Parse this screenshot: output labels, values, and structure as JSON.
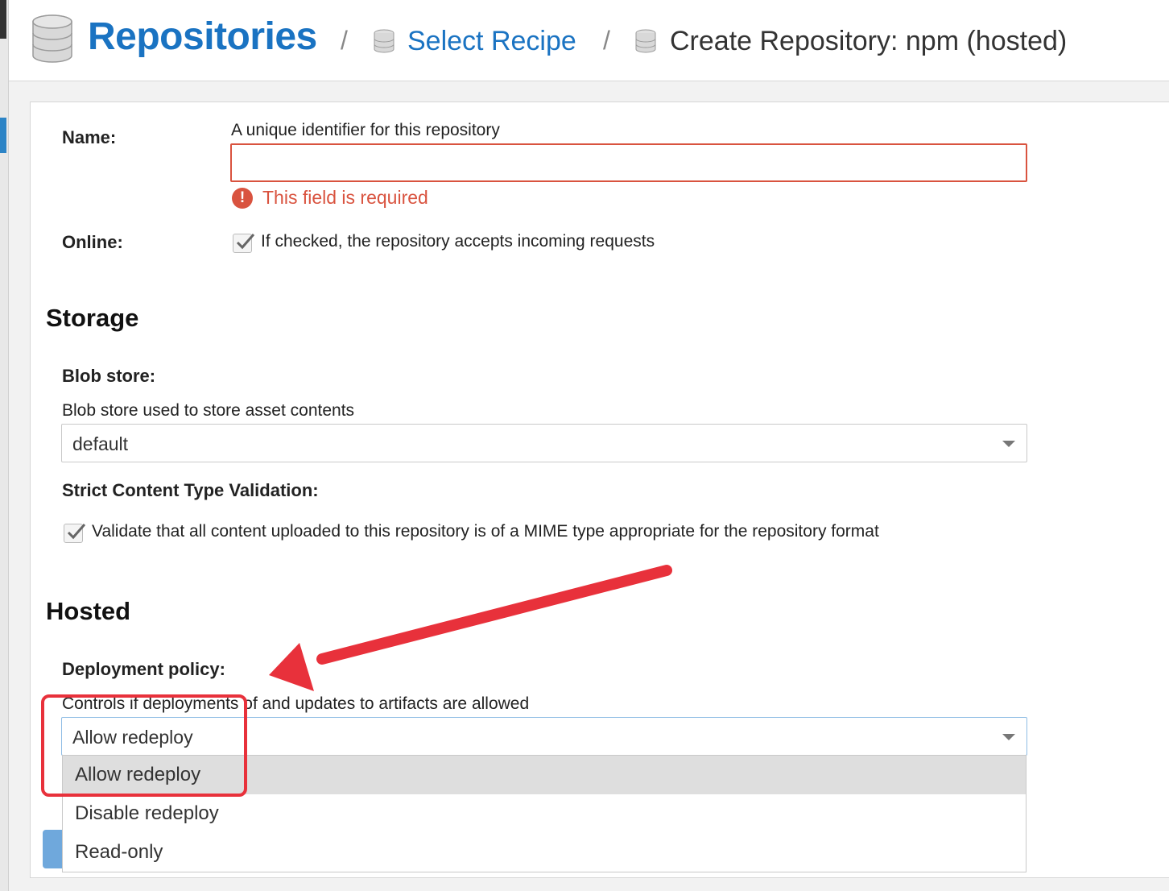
{
  "breadcrumb": {
    "root": "Repositories",
    "separator": "/",
    "select_recipe": "Select Recipe",
    "current": "Create Repository: npm (hosted)",
    "icon": "database-icon"
  },
  "form": {
    "name": {
      "label": "Name:",
      "help": "A unique identifier for this repository",
      "value": "",
      "error": "This field is required"
    },
    "online": {
      "label": "Online:",
      "checked": true,
      "help": "If checked, the repository accepts incoming requests"
    },
    "storage": {
      "title": "Storage",
      "blob_store": {
        "label": "Blob store:",
        "help": "Blob store used to store asset contents",
        "value": "default"
      },
      "strict_content": {
        "label": "Strict Content Type Validation:",
        "checked": true,
        "help": "Validate that all content uploaded to this repository is of a MIME type appropriate for the repository format"
      }
    },
    "hosted": {
      "title": "Hosted",
      "deployment_policy": {
        "label": "Deployment policy:",
        "help": "Controls if deployments of and updates to artifacts are allowed",
        "value": "Allow redeploy",
        "options": [
          "Allow redeploy",
          "Disable redeploy",
          "Read-only"
        ],
        "highlighted_option": "Allow redeploy"
      }
    }
  },
  "colors": {
    "accent": "#1a73c2",
    "error": "#d9533f",
    "annotation": "#e8313b"
  }
}
